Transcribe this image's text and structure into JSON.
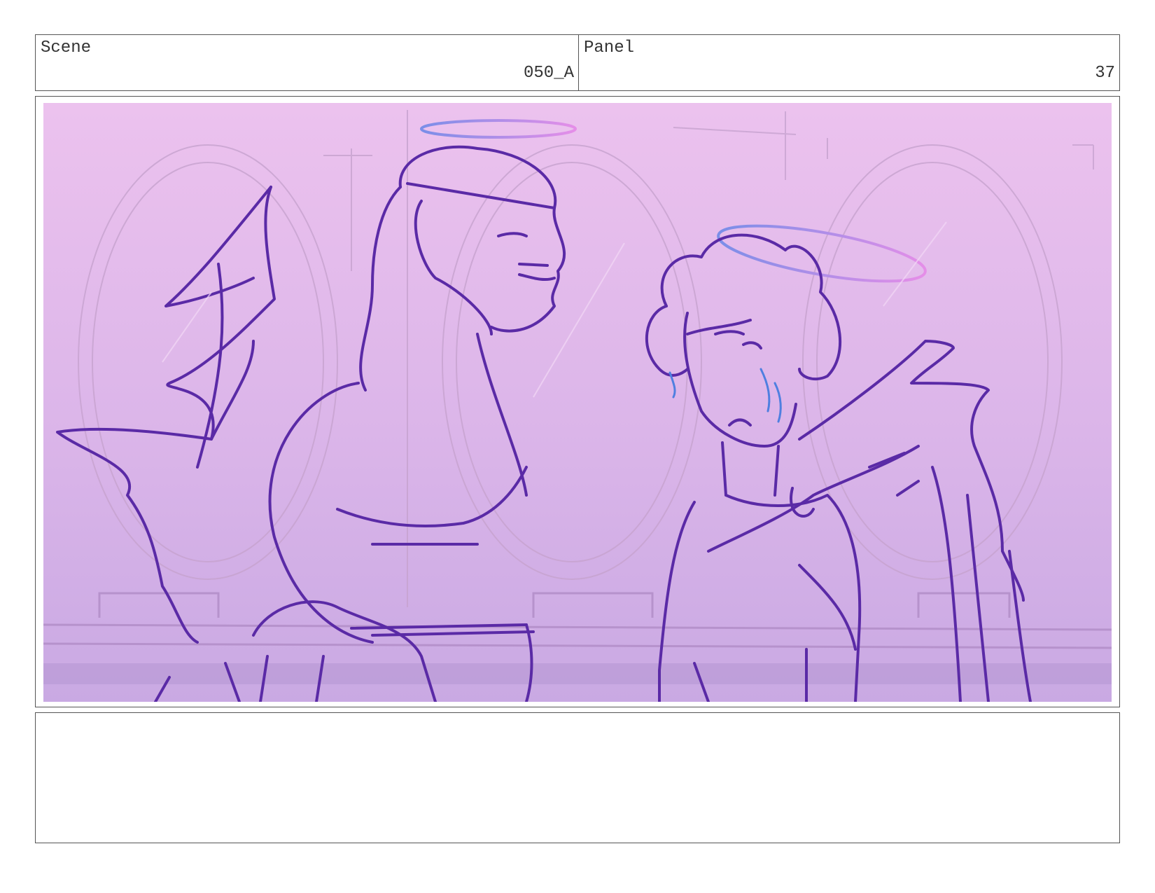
{
  "header": {
    "scene_label": "Scene",
    "scene_value": "050_A",
    "panel_label": "Panel",
    "panel_value": "37"
  },
  "notes": {
    "text": ""
  },
  "colors": {
    "line": "#5a2aa6",
    "sky_top": "#ecc2ee",
    "sky_bottom": "#c9a9e3",
    "halo_start": "#7a8ee8",
    "halo_end": "#e58ee8",
    "tear": "#4f7fe0"
  }
}
